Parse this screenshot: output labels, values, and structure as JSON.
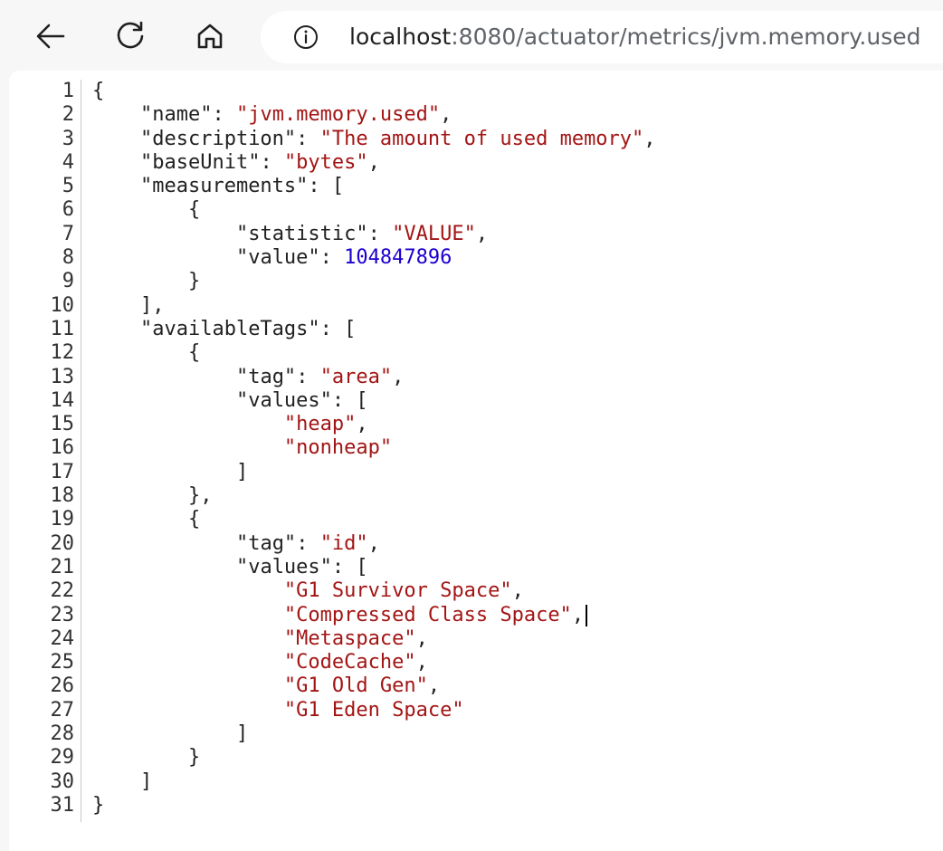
{
  "browser": {
    "url_host": "localhost",
    "url_path": ":8080/actuator/metrics/jvm.memory.used",
    "icons": {
      "back": "arrow-left-icon",
      "reload": "reload-icon",
      "home": "home-icon",
      "info": "info-icon"
    }
  },
  "code_lines": [
    [
      {
        "c": "p",
        "t": "{"
      }
    ],
    [
      {
        "c": "p",
        "t": "    "
      },
      {
        "c": "k",
        "t": "\"name\""
      },
      {
        "c": "p",
        "t": ": "
      },
      {
        "c": "s",
        "t": "\"jvm.memory.used\""
      },
      {
        "c": "p",
        "t": ","
      }
    ],
    [
      {
        "c": "p",
        "t": "    "
      },
      {
        "c": "k",
        "t": "\"description\""
      },
      {
        "c": "p",
        "t": ": "
      },
      {
        "c": "s",
        "t": "\"The amount of used memory\""
      },
      {
        "c": "p",
        "t": ","
      }
    ],
    [
      {
        "c": "p",
        "t": "    "
      },
      {
        "c": "k",
        "t": "\"baseUnit\""
      },
      {
        "c": "p",
        "t": ": "
      },
      {
        "c": "s",
        "t": "\"bytes\""
      },
      {
        "c": "p",
        "t": ","
      }
    ],
    [
      {
        "c": "p",
        "t": "    "
      },
      {
        "c": "k",
        "t": "\"measurements\""
      },
      {
        "c": "p",
        "t": ": ["
      }
    ],
    [
      {
        "c": "p",
        "t": "        {"
      }
    ],
    [
      {
        "c": "p",
        "t": "            "
      },
      {
        "c": "k",
        "t": "\"statistic\""
      },
      {
        "c": "p",
        "t": ": "
      },
      {
        "c": "s",
        "t": "\"VALUE\""
      },
      {
        "c": "p",
        "t": ","
      }
    ],
    [
      {
        "c": "p",
        "t": "            "
      },
      {
        "c": "k",
        "t": "\"value\""
      },
      {
        "c": "p",
        "t": ": "
      },
      {
        "c": "n",
        "t": "104847896"
      }
    ],
    [
      {
        "c": "p",
        "t": "        }"
      }
    ],
    [
      {
        "c": "p",
        "t": "    ],"
      }
    ],
    [
      {
        "c": "p",
        "t": "    "
      },
      {
        "c": "k",
        "t": "\"availableTags\""
      },
      {
        "c": "p",
        "t": ": ["
      }
    ],
    [
      {
        "c": "p",
        "t": "        {"
      }
    ],
    [
      {
        "c": "p",
        "t": "            "
      },
      {
        "c": "k",
        "t": "\"tag\""
      },
      {
        "c": "p",
        "t": ": "
      },
      {
        "c": "s",
        "t": "\"area\""
      },
      {
        "c": "p",
        "t": ","
      }
    ],
    [
      {
        "c": "p",
        "t": "            "
      },
      {
        "c": "k",
        "t": "\"values\""
      },
      {
        "c": "p",
        "t": ": ["
      }
    ],
    [
      {
        "c": "p",
        "t": "                "
      },
      {
        "c": "s",
        "t": "\"heap\""
      },
      {
        "c": "p",
        "t": ","
      }
    ],
    [
      {
        "c": "p",
        "t": "                "
      },
      {
        "c": "s",
        "t": "\"nonheap\""
      }
    ],
    [
      {
        "c": "p",
        "t": "            ]"
      }
    ],
    [
      {
        "c": "p",
        "t": "        },"
      }
    ],
    [
      {
        "c": "p",
        "t": "        {"
      }
    ],
    [
      {
        "c": "p",
        "t": "            "
      },
      {
        "c": "k",
        "t": "\"tag\""
      },
      {
        "c": "p",
        "t": ": "
      },
      {
        "c": "s",
        "t": "\"id\""
      },
      {
        "c": "p",
        "t": ","
      }
    ],
    [
      {
        "c": "p",
        "t": "            "
      },
      {
        "c": "k",
        "t": "\"values\""
      },
      {
        "c": "p",
        "t": ": ["
      }
    ],
    [
      {
        "c": "p",
        "t": "                "
      },
      {
        "c": "s",
        "t": "\"G1 Survivor Space\""
      },
      {
        "c": "p",
        "t": ","
      }
    ],
    [
      {
        "c": "p",
        "t": "                "
      },
      {
        "c": "s",
        "t": "\"Compressed Class Space\""
      },
      {
        "c": "p",
        "t": ","
      },
      {
        "c": "caret",
        "t": ""
      }
    ],
    [
      {
        "c": "p",
        "t": "                "
      },
      {
        "c": "s",
        "t": "\"Metaspace\""
      },
      {
        "c": "p",
        "t": ","
      }
    ],
    [
      {
        "c": "p",
        "t": "                "
      },
      {
        "c": "s",
        "t": "\"CodeCache\""
      },
      {
        "c": "p",
        "t": ","
      }
    ],
    [
      {
        "c": "p",
        "t": "                "
      },
      {
        "c": "s",
        "t": "\"G1 Old Gen\""
      },
      {
        "c": "p",
        "t": ","
      }
    ],
    [
      {
        "c": "p",
        "t": "                "
      },
      {
        "c": "s",
        "t": "\"G1 Eden Space\""
      }
    ],
    [
      {
        "c": "p",
        "t": "            ]"
      }
    ],
    [
      {
        "c": "p",
        "t": "        }"
      }
    ],
    [
      {
        "c": "p",
        "t": "    ]"
      }
    ],
    [
      {
        "c": "p",
        "t": "}"
      }
    ]
  ]
}
